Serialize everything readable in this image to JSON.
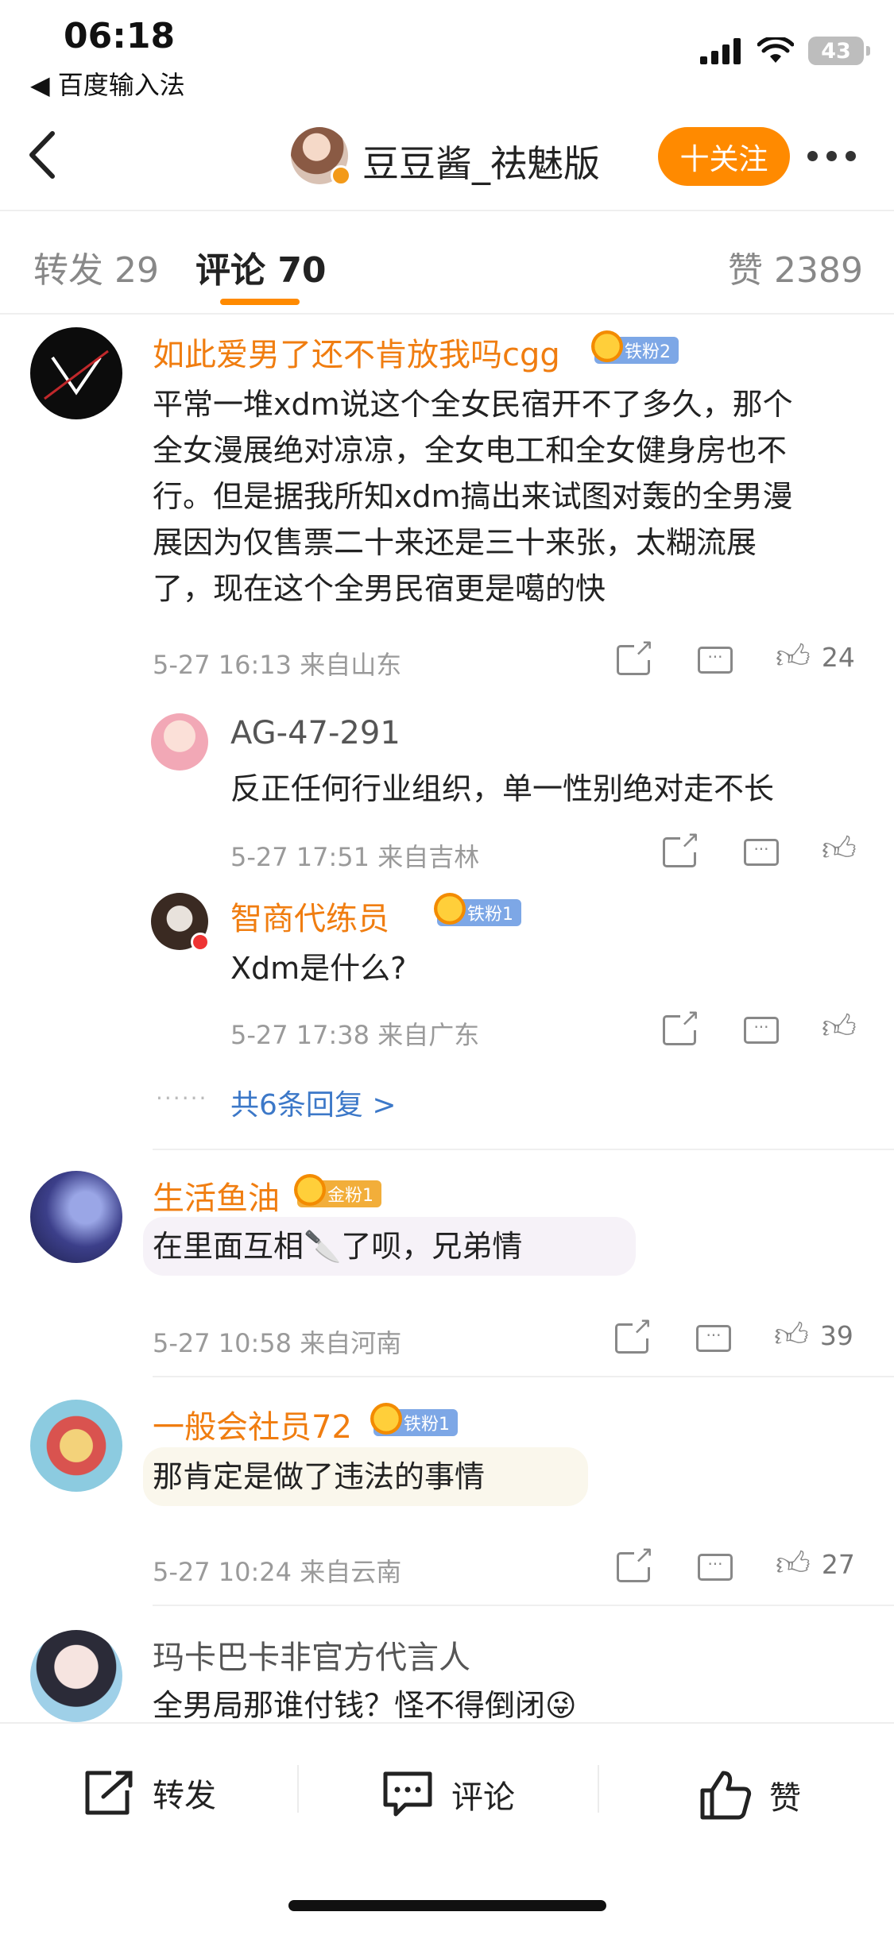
{
  "status_bar": {
    "time": "06:18",
    "back_app": "◀ 百度输入法",
    "battery": "43"
  },
  "header": {
    "title": "豆豆酱_祛魅版",
    "follow_label": "十关注"
  },
  "tabs": {
    "repost": "转发 29",
    "comments": "评论 70",
    "likes": "赞 2389"
  },
  "comments": [
    {
      "name": "如此爱男了还不肯放我吗cgg",
      "badge": "铁粉2",
      "lines": [
        "平常一堆xdm说这个全女民宿开不了多久，那个",
        "全女漫展绝对凉凉，全女电工和全女健身房也不",
        "行。但是据我所知xdm搞出来试图对轰的全男漫",
        "展因为仅售票二十来还是三十来张，太糊流展",
        "了，现在这个全男民宿更是噶的快"
      ],
      "meta": "5-27 16:13  来自山东",
      "likes": "24",
      "replies": [
        {
          "name": "AG-47-291",
          "text": "反正任何行业组织，单一性别绝对走不长",
          "meta": "5-27 17:51  来自吉林"
        },
        {
          "name": "智商代练员",
          "badge": "铁粉1",
          "text": "Xdm是什么?",
          "meta": "5-27 17:38  来自广东"
        }
      ],
      "more_replies": "共6条回复 >"
    },
    {
      "name": "生活鱼油",
      "badge": "金粉1",
      "text": "在里面互相🔪了呗，兄弟情",
      "meta": "5-27 10:58  来自河南",
      "likes": "39"
    },
    {
      "name": "一般会社员72",
      "badge": "铁粉1",
      "text": "那肯定是做了违法的事情",
      "meta": "5-27 10:24  来自云南",
      "likes": "27"
    },
    {
      "name": "玛卡巴卡非官方代言人",
      "text": "全男局那谁付钱？怪不得倒闭😜"
    }
  ],
  "bottom_bar": {
    "repost": "转发",
    "comment": "评论",
    "like": "赞"
  },
  "colors": {
    "accent": "#ff8a00",
    "username": "#f07d10",
    "link": "#3c78c8",
    "iron_badge": "#7da7e6",
    "gold_badge": "#f2ae3a"
  }
}
